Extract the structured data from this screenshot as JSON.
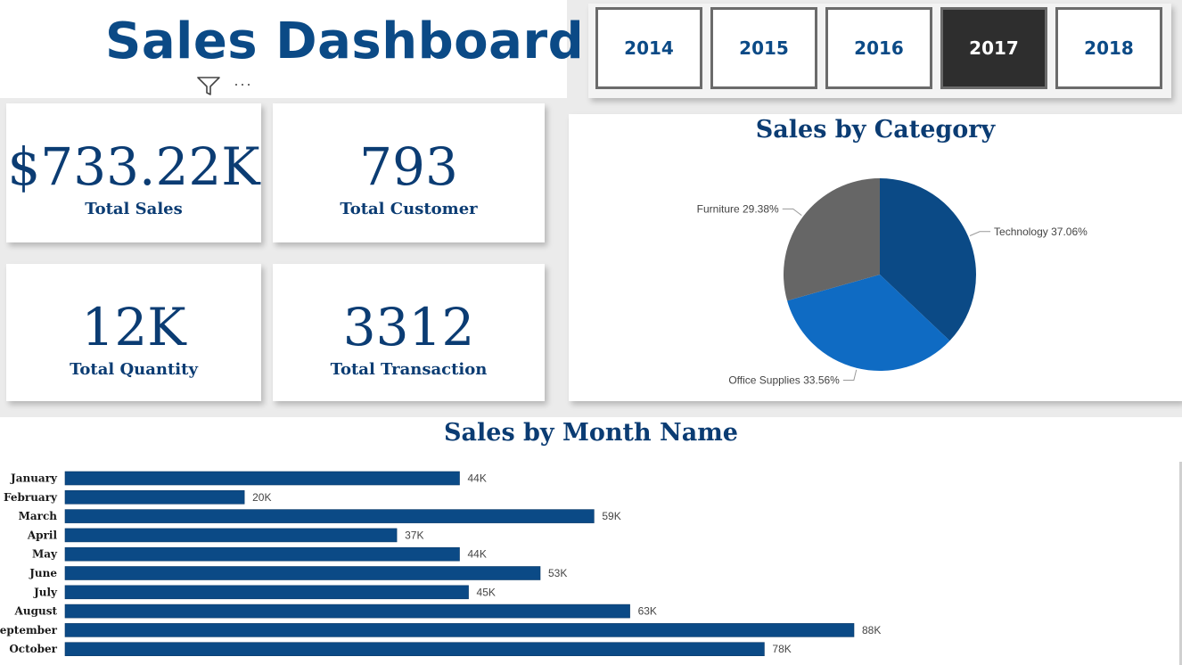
{
  "header": {
    "title": "Sales Dashboard",
    "more_label": "···"
  },
  "slicer": {
    "years": [
      "2014",
      "2015",
      "2016",
      "2017",
      "2018"
    ],
    "selected": "2017"
  },
  "kpis": {
    "total_sales": {
      "value": "$733.22K",
      "label": "Total Sales"
    },
    "total_customer": {
      "value": "793",
      "label": "Total Customer"
    },
    "total_quantity": {
      "value": "12K",
      "label": "Total Quantity"
    },
    "total_transaction": {
      "value": "3312",
      "label": "Total Transaction"
    }
  },
  "chart_data": [
    {
      "type": "pie",
      "title": "Sales by Category",
      "categories": [
        "Technology",
        "Office Supplies",
        "Furniture"
      ],
      "values": [
        37.06,
        33.56,
        29.38
      ],
      "labels": [
        "Technology 37.06%",
        "Office Supplies 33.56%",
        "Furniture 29.38%"
      ],
      "colors": [
        "#0b4a86",
        "#0f6bc3",
        "#666666"
      ]
    },
    {
      "type": "bar",
      "title": "Sales by Month Name",
      "orientation": "horizontal",
      "categories": [
        "January",
        "February",
        "March",
        "April",
        "May",
        "June",
        "July",
        "August",
        "September",
        "October"
      ],
      "values": [
        44,
        20,
        59,
        37,
        44,
        53,
        45,
        63,
        88,
        78
      ],
      "value_labels": [
        "44K",
        "20K",
        "59K",
        "37K",
        "44K",
        "53K",
        "45K",
        "63K",
        "88K",
        "78K"
      ],
      "color": "#0b4a86"
    }
  ]
}
